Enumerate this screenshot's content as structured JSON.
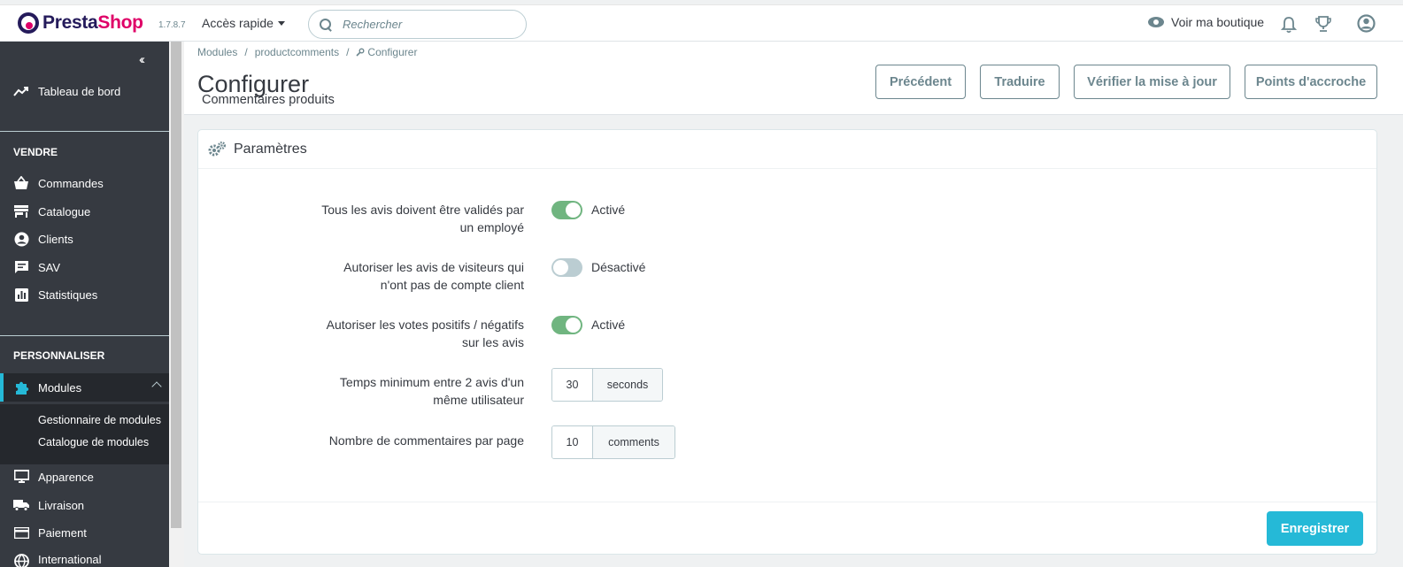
{
  "header": {
    "brand_part1": "Presta",
    "brand_part2": "Shop",
    "version": "1.7.8.7",
    "quick_access": "Accès rapide",
    "search_placeholder": "Rechercher",
    "view_shop": "Voir ma boutique"
  },
  "sidebar": {
    "dashboard": "Tableau de bord",
    "section_sell": "VENDRE",
    "orders": "Commandes",
    "catalog": "Catalogue",
    "customers": "Clients",
    "customer_service": "SAV",
    "stats": "Statistiques",
    "section_customize": "PERSONNALISER",
    "modules": "Modules",
    "module_manager": "Gestionnaire de modules",
    "module_catalog": "Catalogue de modules",
    "design": "Apparence",
    "shipping": "Livraison",
    "payment": "Paiement",
    "international": "International"
  },
  "breadcrumb": {
    "item1": "Modules",
    "item2": "productcomments",
    "item3": "Configurer",
    "separator": "/"
  },
  "page": {
    "title": "Configurer",
    "subtitle": "Commentaires produits"
  },
  "toolbar": {
    "back": "Précédent",
    "translate": "Traduire",
    "check_update": "Vérifier la mise à jour",
    "hooks": "Points d'accroche"
  },
  "panel": {
    "title": "Paramètres",
    "rows": [
      {
        "label_l1": "Tous les avis doivent être validés par",
        "label_l2": "un employé",
        "state": "Activé",
        "on": true
      },
      {
        "label_l1": "Autoriser les avis de visiteurs qui",
        "label_l2": "n'ont pas de compte client",
        "state": "Désactivé",
        "on": false
      },
      {
        "label_l1": "Autoriser les votes positifs / négatifs",
        "label_l2": "sur les avis",
        "state": "Activé",
        "on": true
      }
    ],
    "min_time_label_l1": "Temps minimum entre 2 avis d'un",
    "min_time_label_l2": "même utilisateur",
    "min_time_value": "30",
    "min_time_unit": "seconds",
    "per_page_label": "Nombre de commentaires par page",
    "per_page_value": "10",
    "per_page_unit": "comments",
    "save": "Enregistrer"
  },
  "colors": {
    "sidebar_bg": "#363a41",
    "accent": "#25b9d7",
    "switch_on": "#70b580",
    "switch_off": "#bbcdd2",
    "brand_dark": "#251b5b",
    "brand_pink": "#df0067"
  }
}
